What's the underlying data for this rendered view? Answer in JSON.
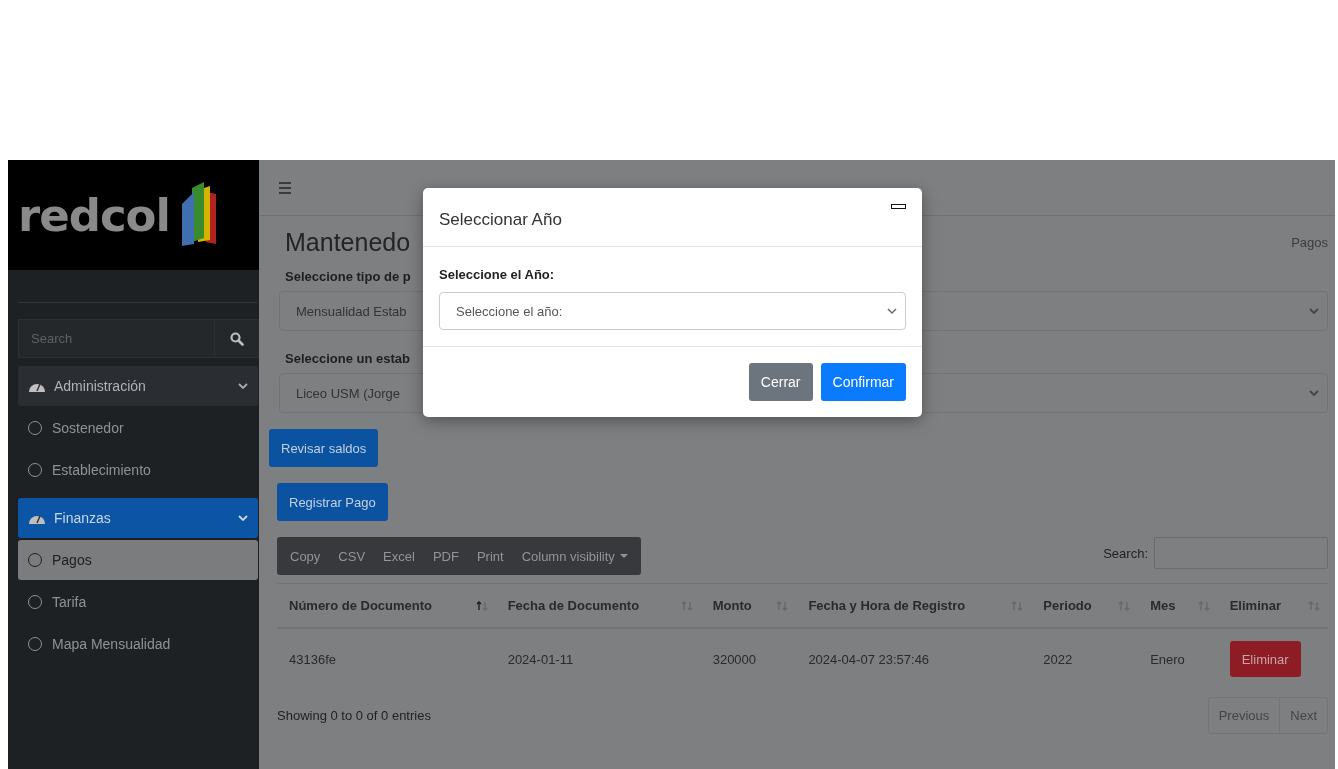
{
  "sidebar": {
    "logo": "redcol",
    "search": {
      "placeholder": "Search"
    },
    "items": [
      {
        "label": "Administración",
        "selected": false,
        "expanded": true,
        "children": [
          {
            "label": "Sostenedor",
            "selected": false
          },
          {
            "label": "Establecimiento",
            "selected": false
          }
        ]
      },
      {
        "label": "Finanzas",
        "selected": true,
        "expanded": true,
        "children": [
          {
            "label": "Pagos",
            "selected": true
          },
          {
            "label": "Tarifa",
            "selected": false
          },
          {
            "label": "Mapa Mensualidad",
            "selected": false
          }
        ]
      }
    ]
  },
  "page": {
    "title": "Mantenedo",
    "breadcrumb": "Pagos",
    "fields": [
      {
        "label": "Seleccione tipo de p",
        "value": "Mensualidad Estab"
      },
      {
        "label": "Seleccione un estab",
        "value": "Liceo USM (Jorge "
      }
    ],
    "buttons": [
      {
        "label": "Revisar saldos"
      },
      {
        "label": "Registrar Pago"
      }
    ]
  },
  "table": {
    "export_buttons": [
      {
        "label": "Copy",
        "kind": "plain"
      },
      {
        "label": "CSV",
        "kind": "plain"
      },
      {
        "label": "Excel",
        "kind": "plain"
      },
      {
        "label": "PDF",
        "kind": "plain"
      },
      {
        "label": "Print",
        "kind": "plain"
      },
      {
        "label": "Column visibility",
        "kind": "dropdown"
      }
    ],
    "search_label": "Search:",
    "columns": [
      {
        "label": "Número de Documento",
        "sorted": true
      },
      {
        "label": "Fecha de Documento",
        "sorted": false
      },
      {
        "label": "Monto",
        "sorted": false
      },
      {
        "label": "Fecha y Hora de Registro",
        "sorted": false
      },
      {
        "label": "Periodo",
        "sorted": false
      },
      {
        "label": "Mes",
        "sorted": false
      },
      {
        "label": "Eliminar",
        "sorted": false
      }
    ],
    "rows": [
      {
        "cells": [
          "43136fe",
          "2024-01-11",
          "320000",
          "2024-04-07 23:57:46",
          "2022",
          "Enero"
        ],
        "action": "Eliminar"
      }
    ],
    "info": "Showing 0 to 0 of 0 entries",
    "pagination": [
      "Previous",
      "Next"
    ]
  },
  "modal": {
    "title": "Seleccionar Año",
    "label": "Seleccione el Año:",
    "select": {
      "placeholder": "Seleccione el año:"
    },
    "buttons": [
      {
        "label": "Cerrar",
        "kind": "secondary"
      },
      {
        "label": "Confirmar",
        "kind": "primary"
      }
    ]
  }
}
